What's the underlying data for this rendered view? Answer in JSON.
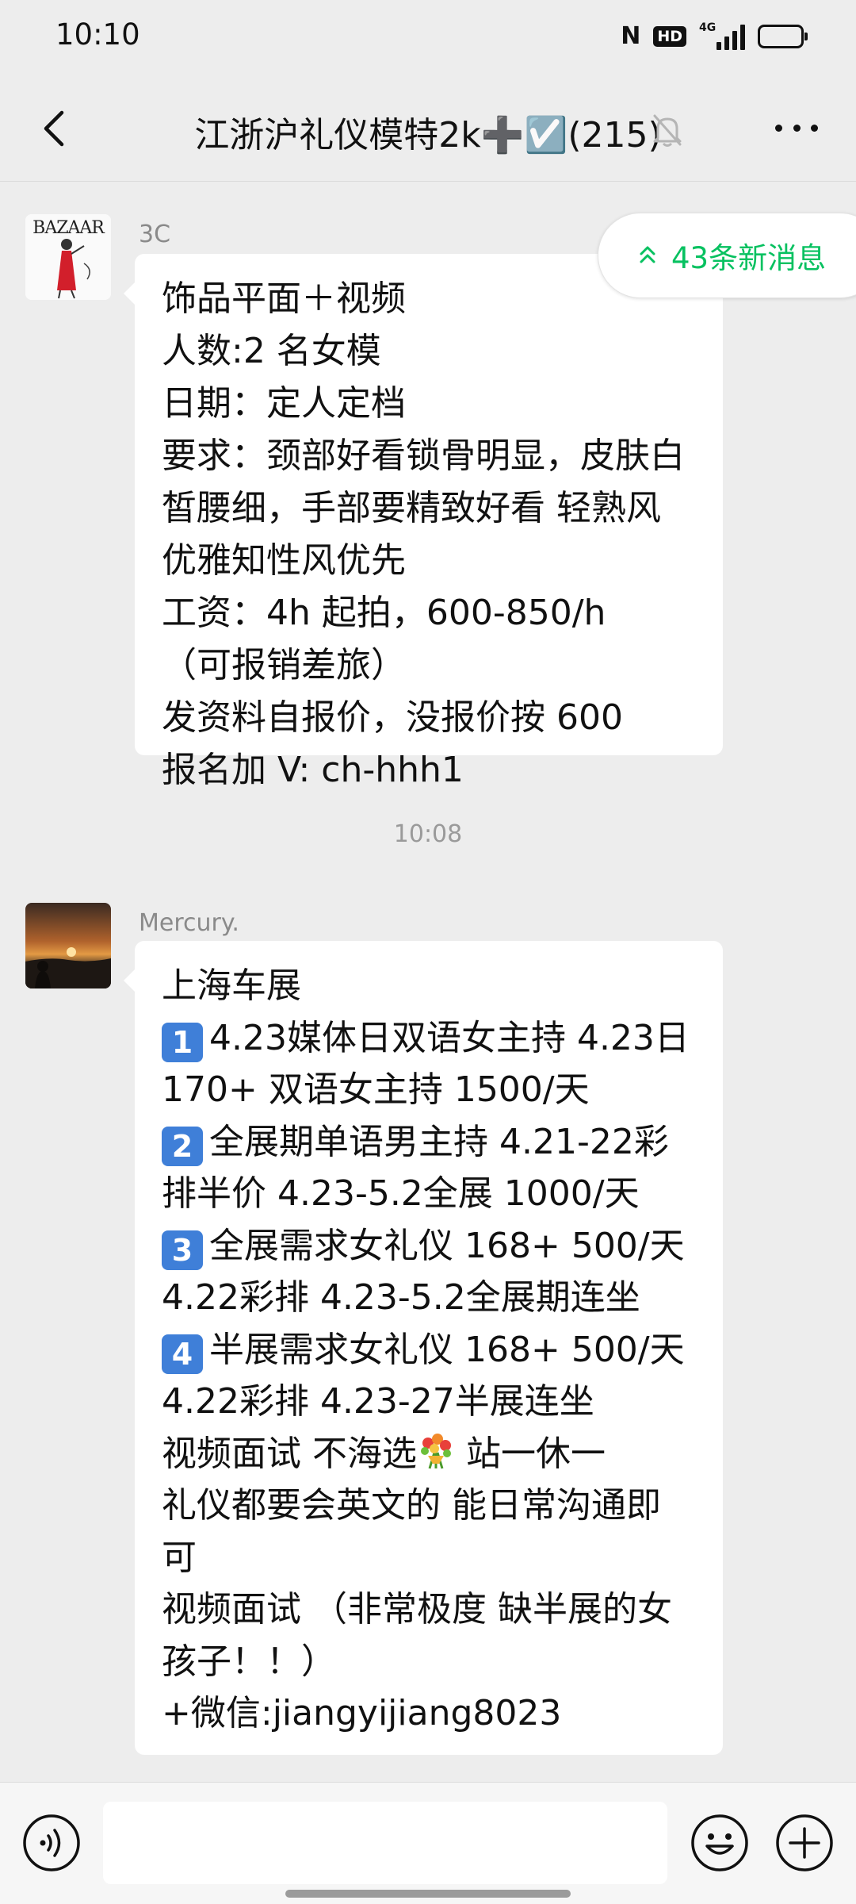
{
  "status_bar": {
    "time": "10:10",
    "nfc_label": "N",
    "hd_label": "HD",
    "network_label": "4G"
  },
  "header": {
    "title": "江浙沪礼仪模特2k➕☑️(215)",
    "back_icon": "chevron-left-icon",
    "mute_icon": "bell-off-icon",
    "more_icon": "more-horizontal-icon"
  },
  "new_messages_pill": {
    "label": "43条新消息",
    "icon": "double-chevron-up-icon",
    "color": "#07c160"
  },
  "messages": [
    {
      "sender": "3C",
      "avatar_text": "BAZAAR",
      "lines": [
        "饰品平面＋视频",
        "人数:2 名女模",
        "日期：定人定档",
        "要求：颈部好看锁骨明显，皮肤白",
        "皙腰细，手部要精致好看 轻熟风",
        "优雅知性风优先",
        "工资：4h 起拍，600-850/h",
        "（可报销差旅）",
        "发资料自报价，没报价按 600",
        "报名加 V: ch-hhh1"
      ]
    },
    {
      "sender": "Mercury.",
      "lines": [
        {
          "text": "上海车展"
        },
        {
          "badge": "1",
          "text": "4.23媒体日双语女主持 4.23日"
        },
        {
          "text": "170+ 双语女主持 1500/天"
        },
        {
          "badge": "2",
          "text": "全展期单语男主持 4.21-22彩"
        },
        {
          "text": "排半价 4.23-5.2全展 1000/天"
        },
        {
          "badge": "3",
          "text": "全展需求女礼仪 168+ 500/天"
        },
        {
          "text": "4.22彩排 4.23-5.2全展期连坐"
        },
        {
          "badge": "4",
          "text": "半展需求女礼仪 168+ 500/天"
        },
        {
          "text": "4.22彩排 4.23-27半展连坐"
        },
        {
          "text": "视频面试 不海选",
          "suffix": " 站一休一",
          "emoji": "bouquet-icon"
        },
        {
          "text": "礼仪都要会英文的  能日常沟通即"
        },
        {
          "text": "可"
        },
        {
          "text": "视频面试 （非常极度 缺半展的女"
        },
        {
          "text": "孩子！！）"
        },
        {
          "text": "+微信:jiangyijiang8023"
        }
      ]
    }
  ],
  "time_divider": "10:08",
  "input_bar": {
    "voice_icon": "voice-icon",
    "input_value": "",
    "emoji_icon": "smiley-icon",
    "plus_icon": "plus-circle-icon"
  },
  "colors": {
    "background": "#ededed",
    "bubble": "#ffffff",
    "accent_green": "#07c160",
    "keycap_blue": "#3f7fd8"
  }
}
